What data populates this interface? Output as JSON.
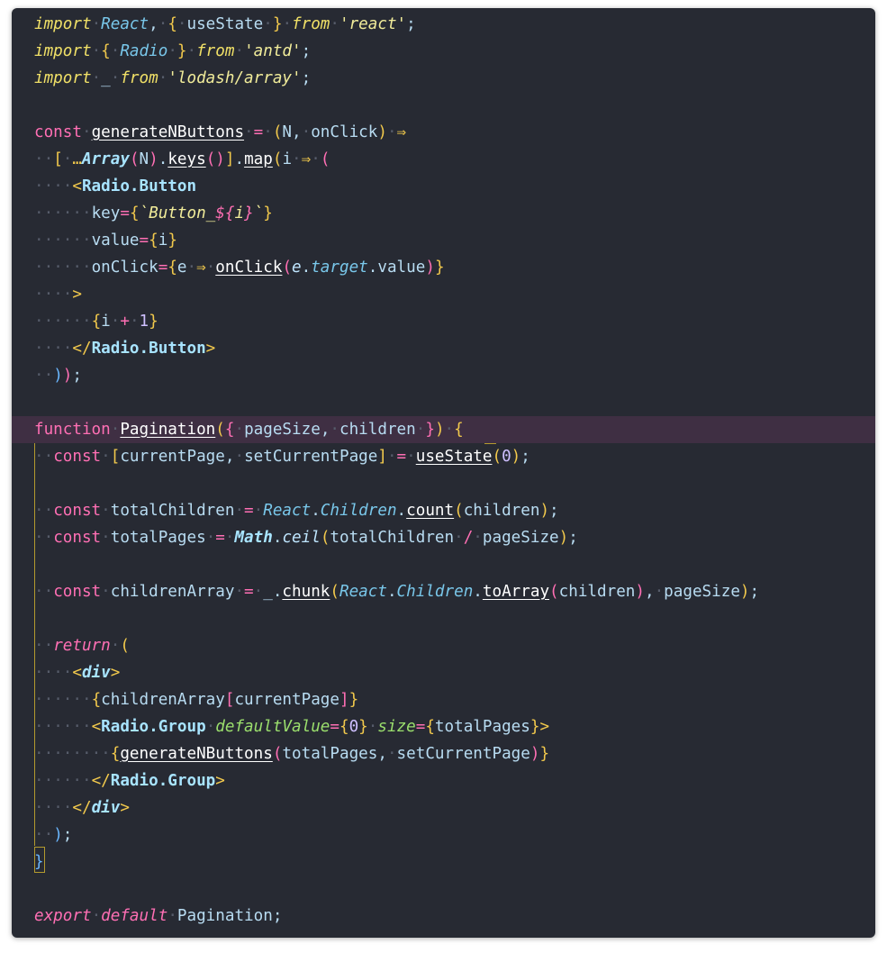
{
  "editor": {
    "theme_colors": {
      "background": "#272a33",
      "highlight_line": "#3f2f43",
      "keyword": "#ff6fb4",
      "string": "#f1ec9a",
      "tag": "#a8e4ff",
      "attribute": "#9bdf6d",
      "bracket_guide": "#b39a2e"
    },
    "code_lines": [
      "import React, { useState } from 'react';",
      "import { Radio } from 'antd';",
      "import _ from 'lodash/array';",
      "",
      "const generateNButtons = (N, onClick) =>",
      "  [ ...Array(N).keys()].map(i => (",
      "    <Radio.Button",
      "      key={`Button_${i}`}",
      "      value={i}",
      "      onClick={e => onClick(e.target.value)}",
      "    >",
      "      {i + 1}",
      "    </Radio.Button>",
      "  ));",
      "",
      "function Pagination({ pageSize, children }) {",
      "  const [currentPage, setCurrentPage] = useState(0);",
      "",
      "  const totalChildren = React.Children.count(children);",
      "  const totalPages = Math.ceil(totalChildren / pageSize);",
      "",
      "  const childrenArray = _.chunk(React.Children.toArray(children), pageSize);",
      "",
      "  return (",
      "    <div>",
      "      {childrenArray[currentPage]}",
      "      <Radio.Group defaultValue={0} size={totalPages}>",
      "        {generateNButtons(totalPages, setCurrentPage)}",
      "      </Radio.Group>",
      "    </div>",
      "  );",
      "}",
      "",
      "export default Pagination;"
    ]
  }
}
